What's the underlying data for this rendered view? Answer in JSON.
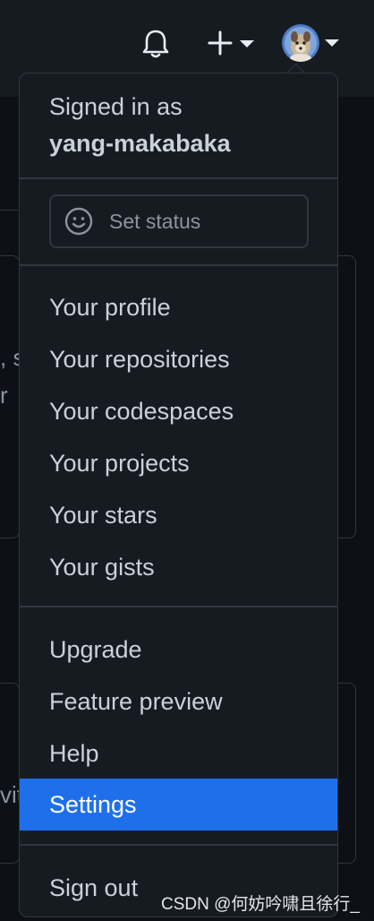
{
  "header": {
    "notifications_icon": "bell-icon",
    "create_icon": "plus-icon",
    "avatar_icon": "user-avatar"
  },
  "background": {
    "fragment_1": ", s",
    "fragment_2": "r",
    "fragment_3": "vit"
  },
  "dropdown": {
    "signed_in_label": "Signed in as",
    "username": "yang-makabaka",
    "set_status": {
      "label": "Set status",
      "icon": "smiley-icon"
    },
    "profile_items": [
      {
        "label": "Your profile"
      },
      {
        "label": "Your repositories"
      },
      {
        "label": "Your codespaces"
      },
      {
        "label": "Your projects"
      },
      {
        "label": "Your stars"
      },
      {
        "label": "Your gists"
      }
    ],
    "misc_items": [
      {
        "label": "Upgrade"
      },
      {
        "label": "Feature preview"
      },
      {
        "label": "Help"
      },
      {
        "label": "Settings",
        "active": true
      }
    ],
    "sign_out": "Sign out"
  },
  "watermark": "CSDN @何妨吟啸且徐行_",
  "colors": {
    "page_bg": "#0d1117",
    "panel_bg": "#161b22",
    "border": "#30363d",
    "text": "#c9d1d9",
    "muted": "#8b949e",
    "active": "#1f6feb"
  }
}
